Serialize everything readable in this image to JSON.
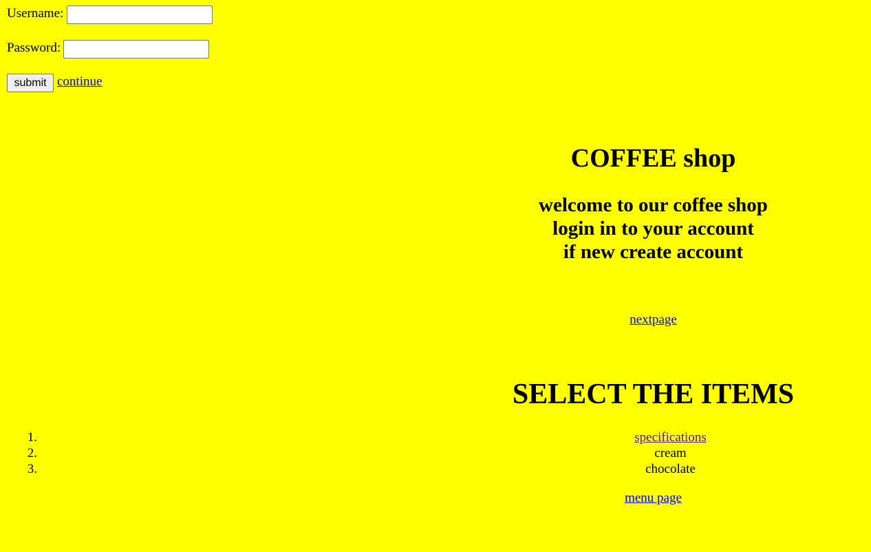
{
  "login": {
    "username_label": "Username:",
    "username_value": "",
    "password_label": "Password:",
    "password_value": "",
    "submit_label": "submit",
    "continue_label": "continue"
  },
  "header": {
    "title": "COFFEE shop",
    "welcome_lines": [
      "welcome to our coffee shop",
      "login in to your account",
      "if new create account"
    ]
  },
  "links": {
    "nextpage": "nextpage",
    "menu_page": "menu page"
  },
  "items": {
    "title": "SELECT THE ITEMS",
    "list": [
      {
        "number": "1.",
        "label": "specifications"
      },
      {
        "number": "2.",
        "label": "cream"
      },
      {
        "number": "3.",
        "label": "chocolate"
      }
    ]
  },
  "colors": {
    "background": "#ffff00",
    "link": "#0000ee",
    "visited_link": "#551a8b"
  }
}
